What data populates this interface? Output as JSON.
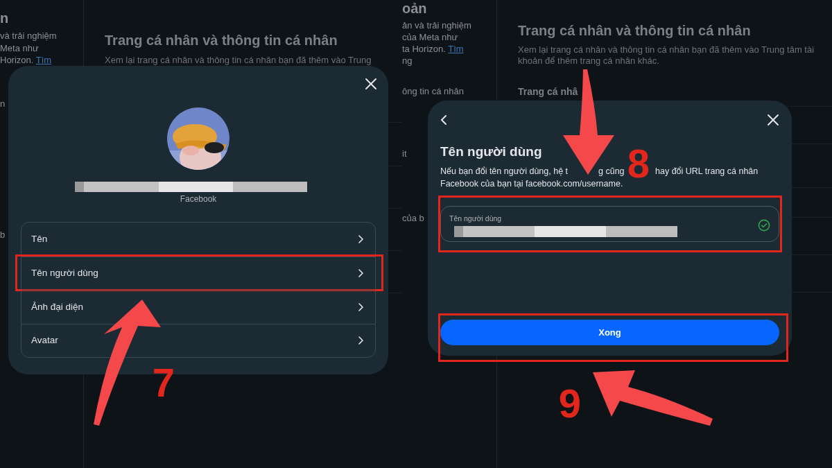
{
  "screens": [
    {
      "sidebar": [
        {
          "kind": "title",
          "lines": [
            {
              "text": "n"
            }
          ]
        },
        {
          "kind": "text",
          "lines": [
            {
              "text": "và trải nghiệm"
            },
            {
              "text": "Meta như"
            },
            {
              "text": "Horizon.",
              "link": "Tìm"
            }
          ]
        },
        {
          "kind": "text",
          "lines": [
            {
              "text": "n"
            }
          ]
        },
        {
          "kind": "text",
          "lines": [
            {
              "text": "b"
            }
          ]
        }
      ],
      "heading": "Trang cá nhân và thông tin cá nhân",
      "description_lines": [
        "Xem lại trang cá nhân và thông tin cá nhân bạn đã thêm vào Trung"
      ]
    },
    {
      "sidebar": [
        {
          "kind": "title",
          "lines": [
            {
              "text": "oản"
            }
          ]
        },
        {
          "kind": "text",
          "lines": [
            {
              "text": "ản và trải nghiệm"
            },
            {
              "text": "của Meta như"
            },
            {
              "text": "ta Horizon.",
              "link": "Tìm"
            },
            {
              "text": "ng"
            }
          ]
        },
        {
          "kind": "text",
          "lines": [
            {
              "text": "ông tin cá nhân"
            }
          ]
        },
        {
          "kind": "text",
          "lines": [
            {
              "text": "it"
            }
          ]
        },
        {
          "kind": "text",
          "lines": [
            {
              "text": "của b"
            }
          ]
        }
      ],
      "heading": "Trang cá nhân và thông tin cá nhân",
      "description_lines": [
        "Xem lại trang cá nhân và thông tin cá nhân bạn đã thêm vào Trung tâm tài",
        "khoản để thêm trang cá nhân khác."
      ],
      "section": "Trang cá nhâ"
    }
  ],
  "profile_dialog": {
    "subtitle": "Facebook",
    "items": [
      {
        "label": "Tên",
        "highlighted": false
      },
      {
        "label": "Tên người dùng",
        "highlighted": true
      },
      {
        "label": "Ảnh đại diện",
        "highlighted": false
      },
      {
        "label": "Avatar",
        "highlighted": false
      }
    ]
  },
  "username_dialog": {
    "title": "Tên người dùng",
    "description_lines": [
      [
        "Nếu bạn đổi tên người dùng, hệ t",
        "g cũng",
        "hay đổi URL trang cá nhân"
      ],
      [
        "Facebook của bạn tại facebook.com/username."
      ]
    ],
    "field": {
      "label": "Tên người dùng",
      "valid": true,
      "highlighted": true
    },
    "button": {
      "label": "Xong",
      "highlighted": true
    }
  },
  "annotations": [
    {
      "label": "7"
    },
    {
      "label": "8"
    },
    {
      "label": "9"
    }
  ]
}
